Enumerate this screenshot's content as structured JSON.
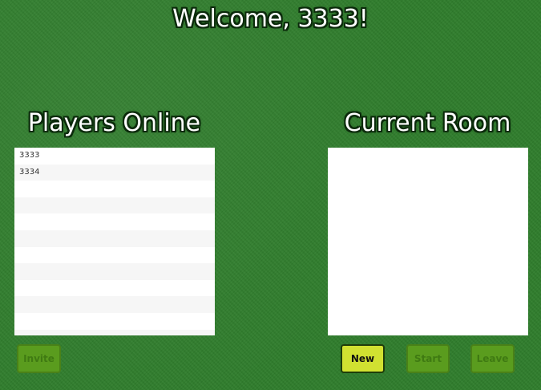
{
  "header": {
    "welcome": "Welcome, 3333!"
  },
  "players_panel": {
    "title": "Players Online",
    "players": [
      "3333",
      "3334",
      "",
      "",
      "",
      "",
      "",
      "",
      "",
      "",
      "",
      ""
    ],
    "invite_label": "Invite"
  },
  "room_panel": {
    "title": "Current Room",
    "members": [],
    "new_label": "New",
    "start_label": "Start",
    "leave_label": "Leave"
  },
  "colors": {
    "felt": "#2f7d2c",
    "active_button": "#d1e131",
    "disabled_button": "#5a9c1e"
  }
}
